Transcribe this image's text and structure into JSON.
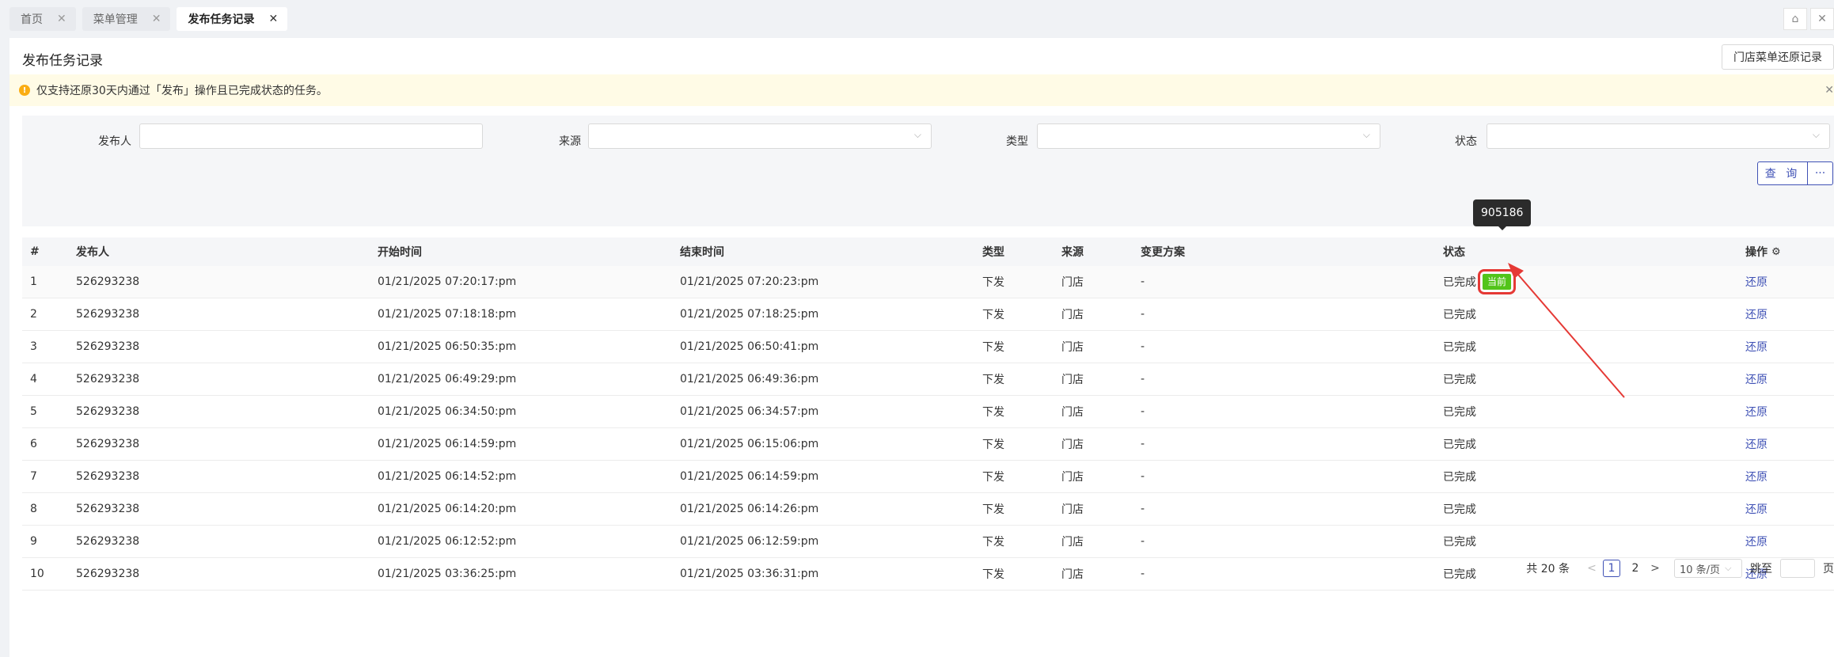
{
  "tabs": [
    {
      "label": "首页",
      "active": false
    },
    {
      "label": "菜单管理",
      "active": false
    },
    {
      "label": "发布任务记录",
      "active": true
    }
  ],
  "page": {
    "title": "发布任务记录",
    "restore_record_button": "门店菜单还原记录"
  },
  "alert": {
    "text": "仅支持还原30天内通过「发布」操作且已完成状态的任务。"
  },
  "filters": {
    "publisher_label": "发布人",
    "source_label": "来源",
    "type_label": "类型",
    "status_label": "状态",
    "query_button": "查 询",
    "more_button": "···"
  },
  "table": {
    "headers": {
      "index": "#",
      "publisher": "发布人",
      "start": "开始时间",
      "end": "结束时间",
      "type": "类型",
      "source": "来源",
      "plan": "变更方案",
      "status": "状态",
      "op": "操作"
    },
    "rows": [
      {
        "index": "1",
        "publisher": "526293238",
        "start": "01/21/2025 07:20:17:pm",
        "end": "01/21/2025 07:20:23:pm",
        "type": "下发",
        "source": "门店",
        "plan": "-",
        "status": "已完成",
        "op": "还原"
      },
      {
        "index": "2",
        "publisher": "526293238",
        "start": "01/21/2025 07:18:18:pm",
        "end": "01/21/2025 07:18:25:pm",
        "type": "下发",
        "source": "门店",
        "plan": "-",
        "status": "已完成",
        "op": "还原"
      },
      {
        "index": "3",
        "publisher": "526293238",
        "start": "01/21/2025 06:50:35:pm",
        "end": "01/21/2025 06:50:41:pm",
        "type": "下发",
        "source": "门店",
        "plan": "-",
        "status": "已完成",
        "op": "还原"
      },
      {
        "index": "4",
        "publisher": "526293238",
        "start": "01/21/2025 06:49:29:pm",
        "end": "01/21/2025 06:49:36:pm",
        "type": "下发",
        "source": "门店",
        "plan": "-",
        "status": "已完成",
        "op": "还原"
      },
      {
        "index": "5",
        "publisher": "526293238",
        "start": "01/21/2025 06:34:50:pm",
        "end": "01/21/2025 06:34:57:pm",
        "type": "下发",
        "source": "门店",
        "plan": "-",
        "status": "已完成",
        "op": "还原"
      },
      {
        "index": "6",
        "publisher": "526293238",
        "start": "01/21/2025 06:14:59:pm",
        "end": "01/21/2025 06:15:06:pm",
        "type": "下发",
        "source": "门店",
        "plan": "-",
        "status": "已完成",
        "op": "还原"
      },
      {
        "index": "7",
        "publisher": "526293238",
        "start": "01/21/2025 06:14:52:pm",
        "end": "01/21/2025 06:14:59:pm",
        "type": "下发",
        "source": "门店",
        "plan": "-",
        "status": "已完成",
        "op": "还原"
      },
      {
        "index": "8",
        "publisher": "526293238",
        "start": "01/21/2025 06:14:20:pm",
        "end": "01/21/2025 06:14:26:pm",
        "type": "下发",
        "source": "门店",
        "plan": "-",
        "status": "已完成",
        "op": "还原"
      },
      {
        "index": "9",
        "publisher": "526293238",
        "start": "01/21/2025 06:12:52:pm",
        "end": "01/21/2025 06:12:59:pm",
        "type": "下发",
        "source": "门店",
        "plan": "-",
        "status": "已完成",
        "op": "还原"
      },
      {
        "index": "10",
        "publisher": "526293238",
        "start": "01/21/2025 03:36:25:pm",
        "end": "01/21/2025 03:36:31:pm",
        "type": "下发",
        "source": "门店",
        "plan": "-",
        "status": "已完成",
        "op": "还原"
      }
    ],
    "current_tag": "当前",
    "tooltip": "905186"
  },
  "pagination": {
    "total": "共 20 条",
    "pages": [
      "1",
      "2"
    ],
    "page_size": "10 条/页",
    "jump_label": "跳至",
    "page_suffix": "页"
  },
  "colors": {
    "accent": "#3f51b5",
    "success_tag": "#52c41a",
    "annotation": "#e53935",
    "alert_bg": "#fffbe6"
  }
}
